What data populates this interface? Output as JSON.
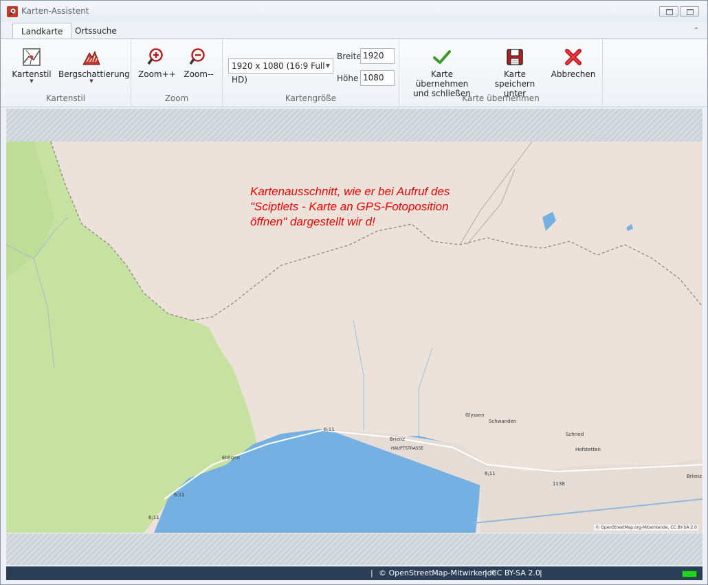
{
  "window": {
    "title": "Karten-Assistent"
  },
  "tabs": [
    {
      "label": "Landkarte",
      "active": true
    },
    {
      "label": "Ortssuche",
      "active": false
    }
  ],
  "ribbon": {
    "kartenstil": {
      "group_label": "Kartenstil",
      "kartenstil_label": "Kartenstil",
      "bergschattierung_label": "Bergschattierung"
    },
    "zoom": {
      "group_label": "Zoom",
      "zoom_in_label": "Zoom++",
      "zoom_out_label": "Zoom--"
    },
    "kartengroesse": {
      "group_label": "Kartengröße",
      "preset_value": "1920 x 1080 (16:9 Full HD)",
      "breite_label": "Breite",
      "breite_value": "1920",
      "hoehe_label": "Höhe",
      "hoehe_value": "1080"
    },
    "uebernehmen": {
      "group_label": "Karte übernehmen",
      "apply_line1": "Karte übernehmen",
      "apply_line2": "und schließen",
      "save_line1": "Karte speichern",
      "save_line2": "unter",
      "cancel_label": "Abbrechen"
    }
  },
  "map": {
    "overlay_line1": "Kartenausschnitt, wie er  bei Aufruf des",
    "overlay_line2": "\"Sciptlets - Karte an GPS-Fotoposition",
    "overlay_line3": "öffnen\" dargestellt wir d!",
    "places": {
      "brienz": "Brienz",
      "schwanden": "Schwanden",
      "hofstetten": "Hofstetten",
      "ebligen": "Ebligen",
      "glyssen": "Glyssen",
      "schried": "Schried",
      "brienz_right": "Brienz"
    },
    "roads": {
      "r611a": "6;11",
      "r611b": "6;11",
      "r611c": "6;11",
      "r611d": "6;11",
      "r1138": "1138",
      "hauptstrasse": "HAUPTSTRASSE"
    },
    "attribution": "© OpenStreetMap.org-Mitwirkende, CC BY-SA 2.0"
  },
  "statusbar": {
    "osm": "© OpenStreetMap-Mitwirkende",
    "license": "CC BY-SA 2.0"
  },
  "icons": {
    "app": "app-icon",
    "kartenstil": "map-style-icon",
    "berg": "hillshade-icon",
    "zoom_in": "zoom-in-icon",
    "zoom_out": "zoom-out-icon",
    "apply": "checkmark-icon",
    "save": "floppy-disk-icon",
    "cancel": "red-x-icon"
  },
  "colors": {
    "water": "#74b0e2",
    "forest": "#c7e1a0",
    "land": "#ede2da",
    "statusbar": "#2b3e56",
    "overlay_text": "#e60000"
  }
}
